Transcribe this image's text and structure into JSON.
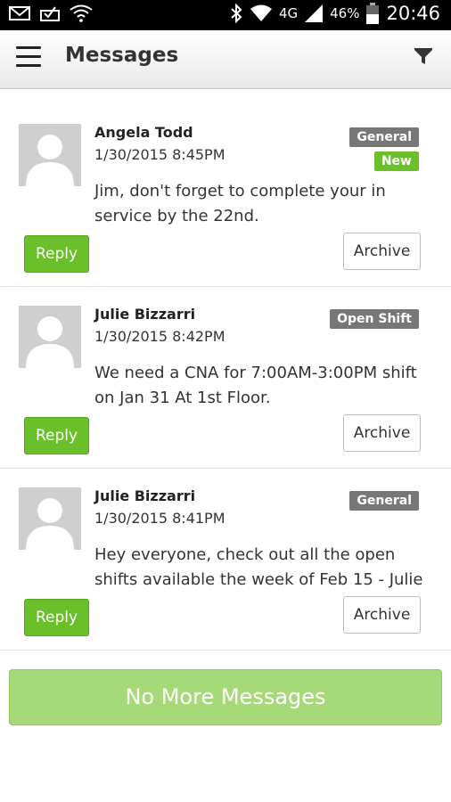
{
  "status_bar": {
    "battery": "46%",
    "network": "4G",
    "time": "20:46",
    "icons": [
      "mail-icon",
      "mailbox-icon",
      "wifi-question-icon",
      "bluetooth-icon",
      "wifi-icon",
      "signal-icon",
      "battery-icon"
    ]
  },
  "header": {
    "title": "Messages",
    "menu_icon": "hamburger-menu-icon",
    "filter_icon": "filter-icon"
  },
  "messages": [
    {
      "sender": "Angela Todd",
      "date": "1/30/2015 8:45PM",
      "tags": [
        "General",
        "New"
      ],
      "body": "Jim, don't forget to complete your in service by the 22nd.",
      "reply_label": "Reply",
      "archive_label": "Archive"
    },
    {
      "sender": "Julie Bizzarri",
      "date": "1/30/2015 8:42PM",
      "tags": [
        "Open Shift"
      ],
      "body": "We need a CNA for 7:00AM-3:00PM shift on Jan 31 At 1st Floor.",
      "reply_label": "Reply",
      "archive_label": "Archive"
    },
    {
      "sender": "Julie Bizzarri",
      "date": "1/30/2015 8:41PM",
      "tags": [
        "General"
      ],
      "body": "Hey everyone, check out all the open shifts available the week of Feb 15 - Julie",
      "reply_label": "Reply",
      "archive_label": "Archive"
    }
  ],
  "footer": {
    "no_more_label": "No More Messages"
  },
  "colors": {
    "accent_green": "#6bbf2a",
    "tag_gray": "#777777",
    "no_more_bg": "#a6d977"
  }
}
